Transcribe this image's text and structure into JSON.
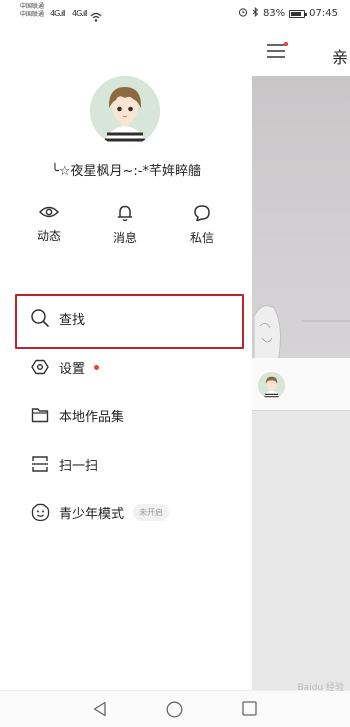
{
  "status_bar": {
    "carrier_line1": "中国联通",
    "carrier_line2": "中国联通",
    "signal1": "4G.ıll",
    "signal2": "4G.ıll",
    "battery_pct": "83%",
    "time": "07:45",
    "icons": [
      "signal-icon",
      "wifi-icon",
      "alarm-icon",
      "bluetooth-icon",
      "battery-icon"
    ]
  },
  "profile": {
    "username": "╰☆夜星枫月~:-*芊姩睟艢"
  },
  "quick_actions": [
    {
      "label": "动态",
      "icon": "eye-icon"
    },
    {
      "label": "消息",
      "icon": "bell-icon"
    },
    {
      "label": "私信",
      "icon": "chat-bubble-icon"
    }
  ],
  "menu": {
    "search": {
      "label": "查找",
      "icon": "search-icon"
    },
    "settings": {
      "label": "设置",
      "icon": "hexagon-settings-icon",
      "has_dot": true
    },
    "local": {
      "label": "本地作品集",
      "icon": "folder-icon"
    },
    "scan": {
      "label": "扫一扫",
      "icon": "scan-icon"
    },
    "youth": {
      "label": "青少年模式",
      "icon": "smiley-icon",
      "badge": "未开启"
    }
  },
  "background": {
    "title_glyph": "亲"
  },
  "watermark": "Baidu 经验",
  "colors": {
    "highlight_border": "#b8252a",
    "dot_red": "#e0453f"
  }
}
